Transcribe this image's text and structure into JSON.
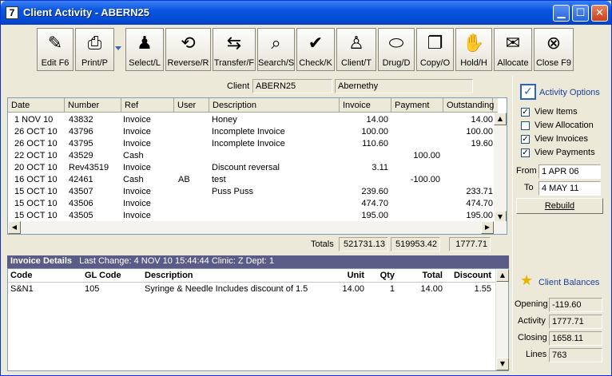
{
  "window": {
    "icon_glyph": "7",
    "title": "Client Activity - ABERN25"
  },
  "toolbar": [
    {
      "name": "edit-button",
      "label": "Edit F6",
      "icon": "edit-icon",
      "glyph": "✎"
    },
    {
      "name": "print-button",
      "label": "Print/P",
      "icon": "printer-icon",
      "glyph": "⎙"
    },
    {
      "name": "select-button",
      "label": "Select/L",
      "icon": "person-select-icon",
      "glyph": "♟"
    },
    {
      "name": "reverse-button",
      "label": "Reverse/R",
      "icon": "reverse-icon",
      "glyph": "⟲"
    },
    {
      "name": "transfer-button",
      "label": "Transfer/F",
      "icon": "transfer-icon",
      "glyph": "⇆"
    },
    {
      "name": "search-button",
      "label": "Search/S",
      "icon": "magnifier-icon",
      "glyph": "⌕"
    },
    {
      "name": "check-button",
      "label": "Check/K",
      "icon": "checkmark-icon",
      "glyph": "✔"
    },
    {
      "name": "client-button",
      "label": "Client/T",
      "icon": "people-icon",
      "glyph": "♙"
    },
    {
      "name": "drug-button",
      "label": "Drug/D",
      "icon": "pill-icon",
      "glyph": "⬭"
    },
    {
      "name": "copy-button",
      "label": "Copy/O",
      "icon": "copy-globe-icon",
      "glyph": "❐"
    },
    {
      "name": "hold-button",
      "label": "Hold/H",
      "icon": "hold-icon",
      "glyph": "✋"
    },
    {
      "name": "allocate-button",
      "label": "Allocate",
      "icon": "allocate-icon",
      "glyph": "✉"
    },
    {
      "name": "close-button",
      "label": "Close F9",
      "icon": "close-circle-icon",
      "glyph": "⊗"
    }
  ],
  "client": {
    "label": "Client",
    "code": "ABERN25",
    "name": "Abernethy"
  },
  "grid": {
    "columns": [
      "Date",
      "Number",
      "Ref",
      "User",
      "Description",
      "Invoice",
      "Payment",
      "Outstanding"
    ],
    "rows": [
      [
        "1 NOV 10",
        "43832",
        "Invoice",
        "",
        "Honey",
        "14.00",
        "",
        "14.00"
      ],
      [
        "26 OCT 10",
        "43796",
        "Invoice",
        "",
        "Incomplete Invoice",
        "100.00",
        "",
        "100.00"
      ],
      [
        "26 OCT 10",
        "43795",
        "Invoice",
        "",
        "Incomplete Invoice",
        "110.60",
        "",
        "19.60"
      ],
      [
        "22 OCT 10",
        "43529",
        "Cash",
        "",
        "",
        "",
        "100.00",
        ""
      ],
      [
        "20 OCT 10",
        "Rev43519",
        "Invoice",
        "",
        "Discount reversal",
        "3.11",
        "",
        ""
      ],
      [
        "16 OCT 10",
        "42461",
        "Cash",
        "AB",
        "test",
        "",
        "-100.00",
        ""
      ],
      [
        "15 OCT 10",
        "43507",
        "Invoice",
        "",
        "Puss Puss",
        "239.60",
        "",
        "233.71"
      ],
      [
        "15 OCT 10",
        "43506",
        "Invoice",
        "",
        "",
        "474.70",
        "",
        "474.70"
      ],
      [
        "15 OCT 10",
        "43505",
        "Invoice",
        "",
        "",
        "195.00",
        "",
        "195.00"
      ]
    ]
  },
  "totals": {
    "label": "Totals",
    "invoice": "521731.13",
    "payment": "519953.42",
    "outstanding": "1777.71"
  },
  "invoice_details": {
    "title": "Invoice Details",
    "meta": "Last Change: 4 NOV 10  15:44:44  Clinic: Z  Dept: 1",
    "columns": [
      "Code",
      "GL Code",
      "Description",
      "Unit",
      "Qty",
      "Total",
      "Discount"
    ],
    "rows": [
      [
        "S&N1",
        "105",
        "Syringe & Needle Includes discount of 1.5",
        "14.00",
        "1",
        "14.00",
        "1.55"
      ]
    ]
  },
  "options": {
    "title": "Activity Options",
    "view_items": {
      "label": "View Items",
      "checked": true
    },
    "view_allocation": {
      "label": "View Allocation",
      "checked": false
    },
    "view_invoices": {
      "label": "View Invoices",
      "checked": true
    },
    "view_payments": {
      "label": "View Payments",
      "checked": true
    },
    "from_label": "From",
    "from_value": "1 APR 06",
    "to_label": "To",
    "to_value": "4 MAY 11",
    "rebuild_label": "Rebuild"
  },
  "balances": {
    "title": "Client Balances",
    "opening_label": "Opening",
    "opening": "-119.60",
    "activity_label": "Activity",
    "activity": "1777.71",
    "closing_label": "Closing",
    "closing": "1658.11",
    "lines_label": "Lines",
    "lines": "763"
  }
}
